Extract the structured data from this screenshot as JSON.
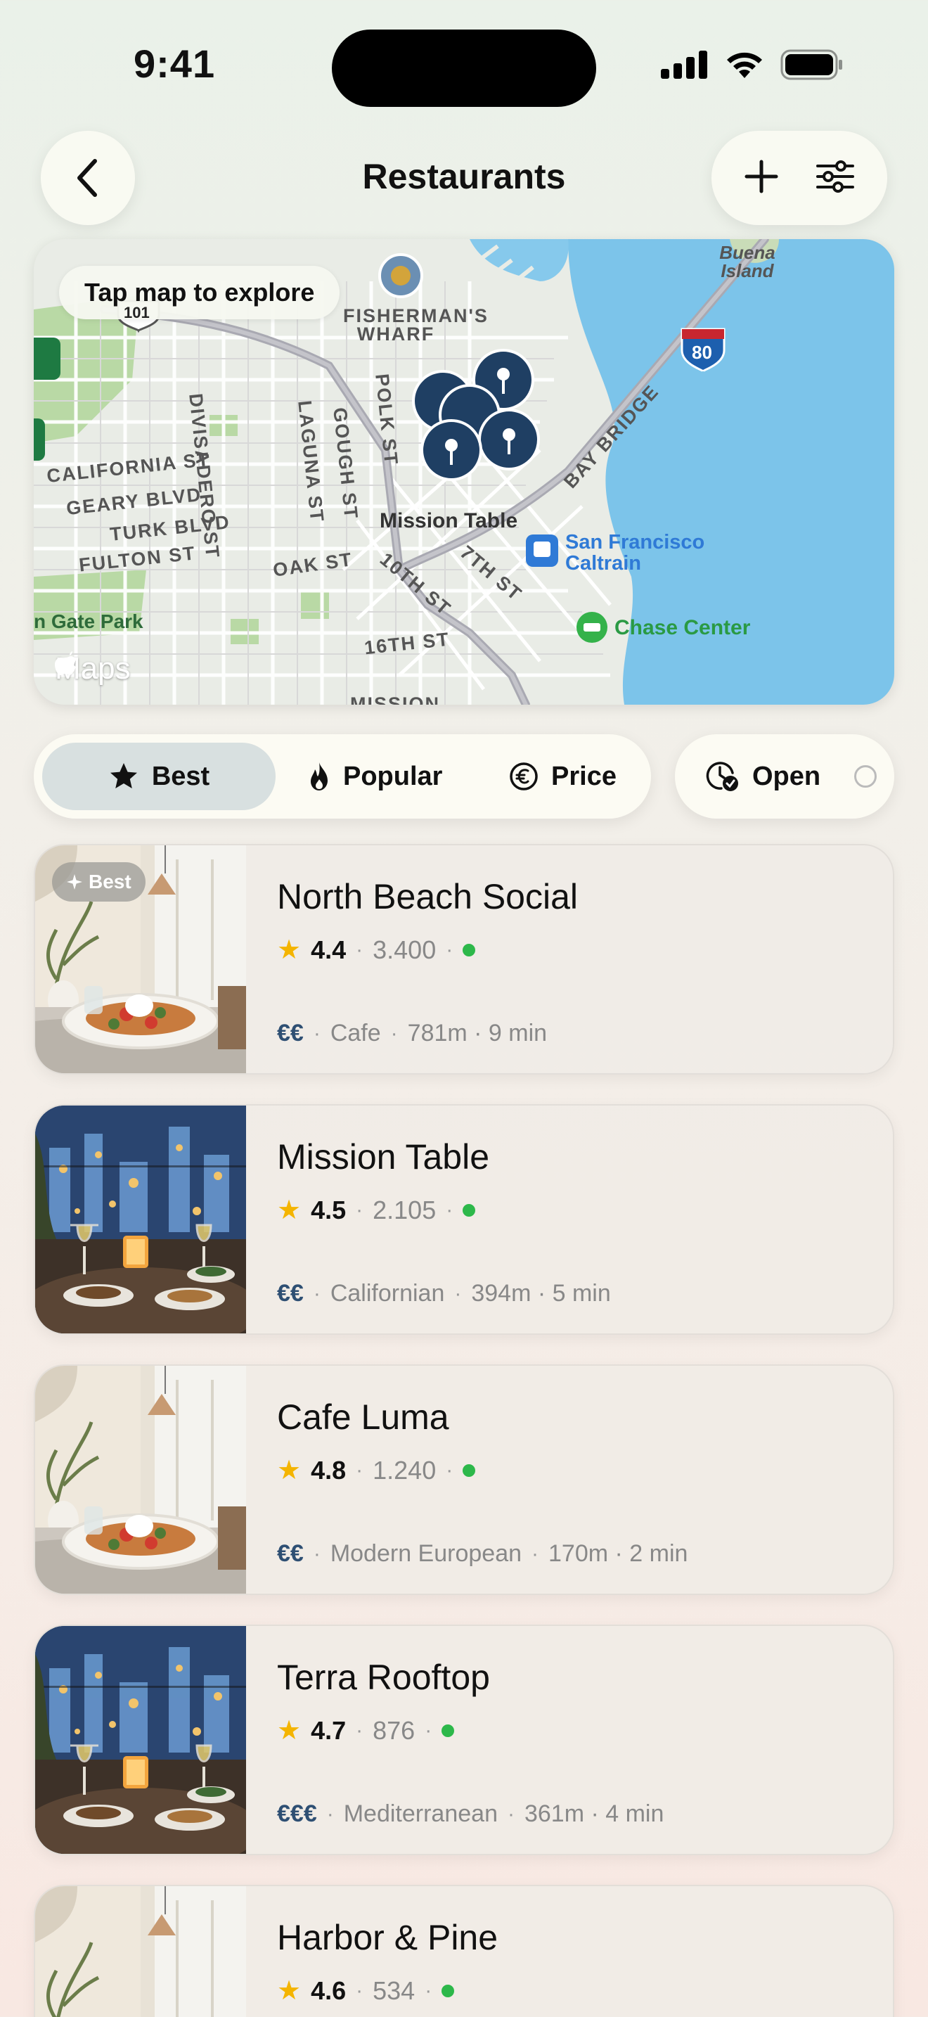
{
  "status_bar": {
    "time": "9:41"
  },
  "header": {
    "title": "Restaurants"
  },
  "map": {
    "chip_label": "Tap map to explore",
    "logo_text": "Maps",
    "street_labels": [
      "CALIFORNIA ST",
      "GEARY BLVD",
      "TURK BLVD",
      "FULTON ST",
      "DIVISADERO ST",
      "LAGUNA ST",
      "GOUGH ST",
      "POLK ST",
      "OAK ST",
      "10TH ST",
      "7TH ST",
      "16TH ST",
      "BAY BRIDGE",
      "FISHERMAN'S WHARF",
      "Buena Island",
      "n Gate Park",
      "MISSION",
      "101",
      "80"
    ],
    "pin_label": "Mission Table",
    "poi_caltrain": "San Francisco Caltrain",
    "poi_chase": "Chase Center"
  },
  "filters": {
    "tabs": [
      {
        "label": "Best",
        "icon": "star-icon",
        "active": true
      },
      {
        "label": "Popular",
        "icon": "flame-icon",
        "active": false
      },
      {
        "label": "Price",
        "icon": "euro-icon",
        "active": false
      }
    ],
    "open_label": "Open"
  },
  "restaurants": [
    {
      "name": "North Beach Social",
      "rating": "4.4",
      "reviews": "3.400",
      "price": "€€",
      "cuisine": "Cafe",
      "distance": "781m · 9 min",
      "badge": "Best",
      "photo": "cafe"
    },
    {
      "name": "Mission Table",
      "rating": "4.5",
      "reviews": "2.105",
      "price": "€€",
      "cuisine": "Californian",
      "distance": "394m · 5 min",
      "photo": "rooftop"
    },
    {
      "name": "Cafe Luma",
      "rating": "4.8",
      "reviews": "1.240",
      "price": "€€",
      "cuisine": "Modern European",
      "distance": "170m · 2 min",
      "photo": "cafe"
    },
    {
      "name": "Terra Rooftop",
      "rating": "4.7",
      "reviews": "876",
      "price": "€€€",
      "cuisine": "Mediterranean",
      "distance": "361m · 4 min",
      "photo": "rooftop"
    },
    {
      "name": "Harbor & Pine",
      "rating": "4.6",
      "reviews": "534",
      "price": "€€",
      "cuisine": "",
      "distance": "",
      "photo": "cafe"
    }
  ]
}
